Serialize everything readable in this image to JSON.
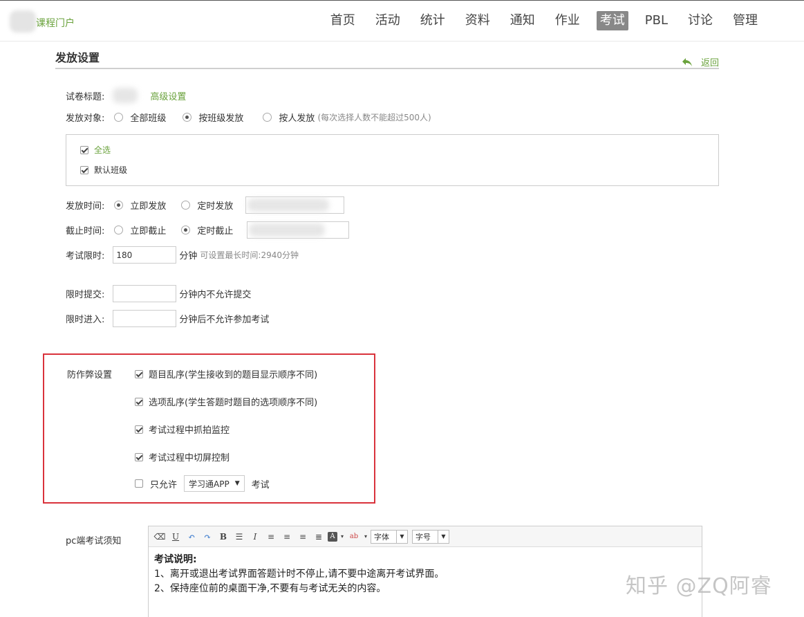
{
  "header": {
    "logo_text": "课程门户",
    "nav": [
      {
        "label": "首页",
        "active": false
      },
      {
        "label": "活动",
        "active": false
      },
      {
        "label": "统计",
        "active": false
      },
      {
        "label": "资料",
        "active": false
      },
      {
        "label": "通知",
        "active": false
      },
      {
        "label": "作业",
        "active": false
      },
      {
        "label": "考试",
        "active": true
      },
      {
        "label": "PBL",
        "active": false
      },
      {
        "label": "讨论",
        "active": false
      },
      {
        "label": "管理",
        "active": false
      }
    ]
  },
  "page": {
    "title": "发放设置",
    "back_label": "返回"
  },
  "form": {
    "paper_title_label": "试卷标题:",
    "advanced_link": "高级设置",
    "target_label": "发放对象:",
    "target_options": [
      "全部班级",
      "按班级发放",
      "按人发放"
    ],
    "target_selected": "按班级发放",
    "target_hint": "(每次选择人数不能超过500人)",
    "select_all_label": "全选",
    "default_class_label": "默认班级",
    "release_time_label": "发放时间:",
    "release_options": [
      "立即发放",
      "定时发放"
    ],
    "deadline_label": "截止时间:",
    "deadline_options": [
      "立即截止",
      "定时截止"
    ],
    "limit_label": "考试限时:",
    "limit_value": "180",
    "limit_unit": "分钟",
    "limit_hint": "可设置最长时间:2940分钟",
    "submit_limit_label": "限时提交:",
    "submit_limit_suffix": "分钟内不允许提交",
    "enter_limit_label": "限时进入:",
    "enter_limit_suffix": "分钟后不允许参加考试"
  },
  "anti_cheat": {
    "label": "防作弊设置",
    "options": [
      "题目乱序(学生接收到的题目显示顺序不同)",
      "选项乱序(学生答题时题目的选项顺序不同)",
      "考试过程中抓拍监控",
      "考试过程中切屏控制"
    ],
    "only_allow_label": "只允许",
    "only_allow_select": "学习通APP",
    "only_allow_suffix": "考试"
  },
  "notice": {
    "label": "pc端考试须知",
    "font_select": "字体",
    "size_select": "字号",
    "heading": "考试说明:",
    "lines": [
      "1、离开或退出考试界面答题计时不停止,请不要中途离开考试界面。",
      "2、保持座位前的桌面干净,不要有与考试无关的内容。"
    ]
  },
  "watermark": "知乎 @ZQ阿睿",
  "colors": {
    "accent_green": "#6aa23c",
    "highlight_red": "#d9323b",
    "nav_active_bg": "#888888"
  }
}
